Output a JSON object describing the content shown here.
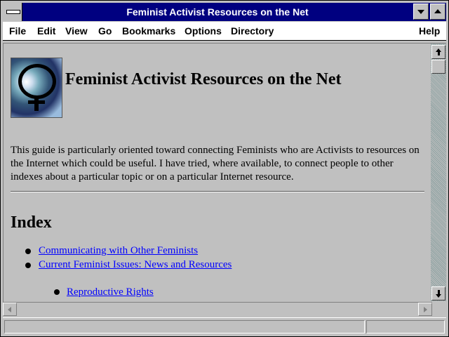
{
  "window": {
    "title": "Feminist Activist Resources on the Net"
  },
  "menu": [
    "File",
    "Edit",
    "View",
    "Go",
    "Bookmarks",
    "Options",
    "Directory",
    "Help"
  ],
  "page": {
    "heading": "Feminist Activist Resources on the Net",
    "intro": "This guide is particularly oriented toward connecting Feminists who are Activists to resources on the Internet which could be useful. I have tried, where available, to connect people to other indexes about a particular topic or on a particular Internet resource.",
    "index_heading": "Index",
    "index_links": [
      "Communicating with Other Feminists",
      "Current Feminist Issues: News and Resources"
    ],
    "sub_links": [
      "Reproductive Rights"
    ]
  },
  "status": {
    "text": ""
  }
}
